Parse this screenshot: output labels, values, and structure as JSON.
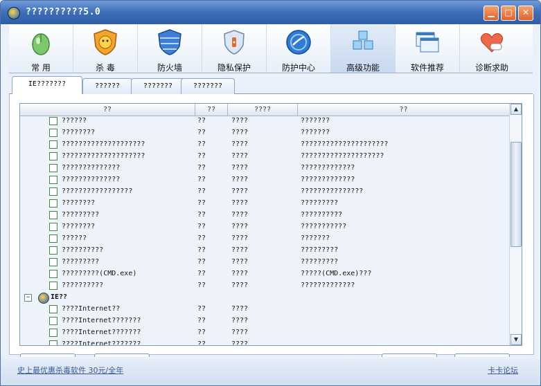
{
  "window": {
    "title": "??????????5.0"
  },
  "toolbar": {
    "items": [
      {
        "label": "常 用"
      },
      {
        "label": "杀 毒"
      },
      {
        "label": "防火墙"
      },
      {
        "label": "隐私保护"
      },
      {
        "label": "防护中心"
      },
      {
        "label": "高级功能"
      },
      {
        "label": "软件推荐"
      },
      {
        "label": "诊断求助"
      }
    ]
  },
  "tabs": [
    "IE???????",
    "??????",
    "???????",
    "???????"
  ],
  "list": {
    "columns": [
      "??",
      "??",
      "????",
      "??"
    ],
    "rows": [
      {
        "name": "??????",
        "c2": "??",
        "c3": "????",
        "c4": "???????"
      },
      {
        "name": "????????",
        "c2": "??",
        "c3": "????",
        "c4": "???????"
      },
      {
        "name": "????????????????????",
        "c2": "??",
        "c3": "????",
        "c4": "?????????????????????"
      },
      {
        "name": "????????????????????",
        "c2": "??",
        "c3": "????",
        "c4": "????????????????????"
      },
      {
        "name": "??????????????",
        "c2": "??",
        "c3": "????",
        "c4": "?????????????"
      },
      {
        "name": "??????????????",
        "c2": "??",
        "c3": "????",
        "c4": "?????????????"
      },
      {
        "name": "?????????????????",
        "c2": "??",
        "c3": "????",
        "c4": "???????????????"
      },
      {
        "name": "????????",
        "c2": "??",
        "c3": "????",
        "c4": "?????????"
      },
      {
        "name": "?????????",
        "c2": "??",
        "c3": "????",
        "c4": "??????????"
      },
      {
        "name": "????????",
        "c2": "??",
        "c3": "????",
        "c4": "???????????"
      },
      {
        "name": "??????",
        "c2": "??",
        "c3": "????",
        "c4": "???????"
      },
      {
        "name": "??????????",
        "c2": "??",
        "c3": "????",
        "c4": "?????????"
      },
      {
        "name": "?????????",
        "c2": "??",
        "c3": "????",
        "c4": "?????????"
      },
      {
        "name": "?????????(CMD.exe)",
        "c2": "??",
        "c3": "????",
        "c4": "?????(CMD.exe)???"
      },
      {
        "name": "??????????",
        "c2": "??",
        "c3": "????",
        "c4": "?????????????"
      }
    ],
    "group": {
      "label": "IE??",
      "toggle": "−"
    },
    "group_rows": [
      {
        "name": "????Internet??",
        "c2": "??",
        "c3": "????"
      },
      {
        "name": "????Internet???????",
        "c2": "??",
        "c3": "????"
      },
      {
        "name": "????Internet???????",
        "c2": "??",
        "c3": "????"
      },
      {
        "name": "????Internet???????",
        "c2": "??",
        "c3": "????"
      }
    ]
  },
  "status": {
    "left_link": "史上最优惠杀毒软件 30元/全年",
    "right_link": "卡卡论坛"
  }
}
